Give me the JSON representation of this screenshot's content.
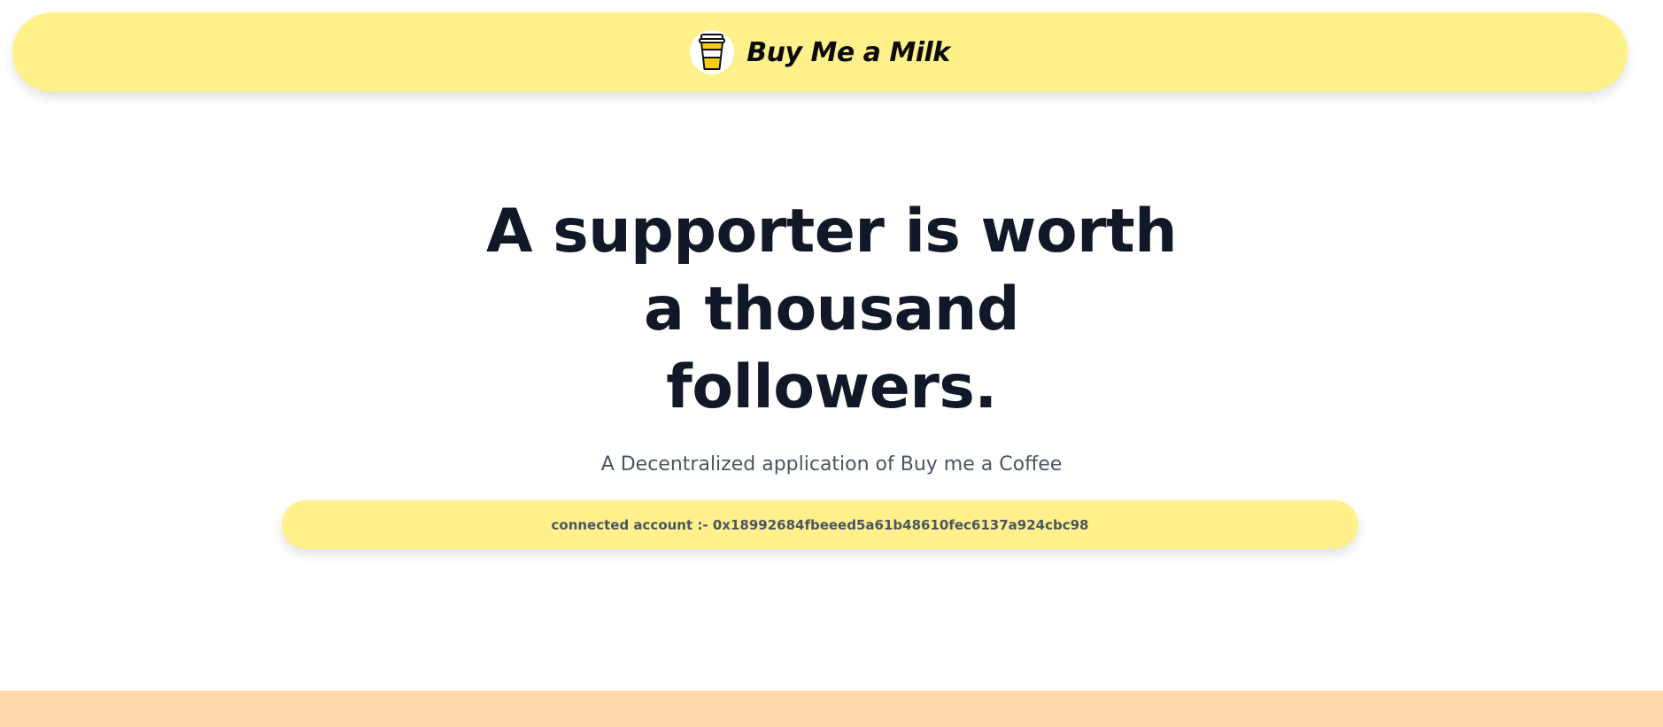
{
  "navbar": {
    "brand_name": "Buy Me a Milk",
    "logo_icon": "milk-cup-icon"
  },
  "hero": {
    "title": "A supporter is worth a thousand followers.",
    "subtitle": "A Decentralized application of Buy me a Coffee"
  },
  "account": {
    "text": "connected account :- 0x18992684fbeeed5a61b48610fec6137a924cbc98"
  },
  "colors": {
    "navbar_bg": "#fef08a",
    "account_bg": "#fef08a",
    "footer_bg": "#fed7aa",
    "title_text": "#111827",
    "subtitle_text": "#4b5563"
  }
}
